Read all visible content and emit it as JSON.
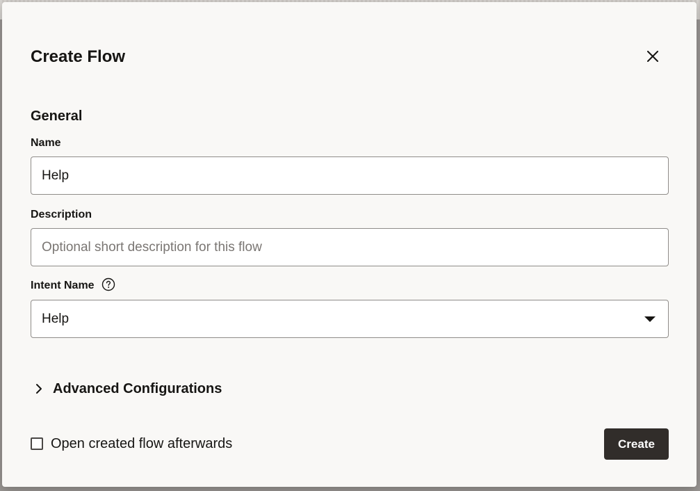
{
  "dialog": {
    "title": "Create Flow",
    "close_icon": "close-icon"
  },
  "general": {
    "section_title": "General",
    "name": {
      "label": "Name",
      "value": "Help",
      "placeholder": ""
    },
    "description": {
      "label": "Description",
      "value": "",
      "placeholder": "Optional short description for this flow"
    },
    "intent_name": {
      "label": "Intent Name",
      "help_icon": "help-circle-icon",
      "selected": "Help",
      "dropdown_icon": "caret-down-icon"
    }
  },
  "advanced": {
    "label": "Advanced Configurations",
    "icon": "chevron-right-icon",
    "expanded": false
  },
  "footer": {
    "checkbox_label": "Open created flow afterwards",
    "checkbox_checked": false,
    "create_label": "Create"
  },
  "colors": {
    "dialog_bg": "#f9f8f6",
    "primary_button": "#312d2a",
    "input_border": "#8f8c89",
    "text": "#161513"
  }
}
